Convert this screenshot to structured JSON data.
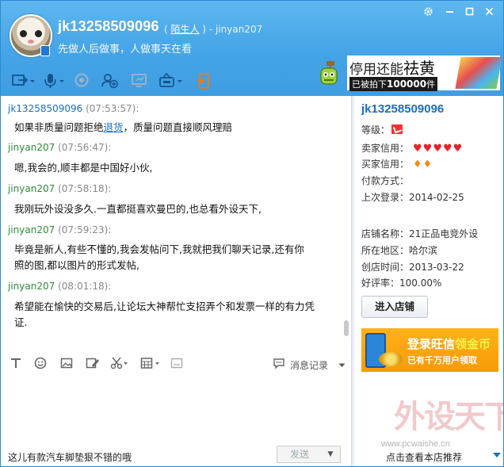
{
  "header": {
    "nickname": "jk13258509096",
    "relation_tag": "陌生人",
    "relation_suffix": " ) - jinyan207",
    "relation_prefix": "( ",
    "motto": "先做人后做事，人做事天在看",
    "window_controls": [
      "settings-icon",
      "minimize-icon",
      "maximize-icon",
      "close-icon"
    ]
  },
  "promo_banner": {
    "line1_a": "停用还能",
    "line1_b": "祛黄",
    "line2_a": "已被拍下",
    "line2_num": "100000",
    "line2_b": "件"
  },
  "messages": [
    {
      "sender": "jk13258509096",
      "time": "(07:53:57):",
      "role": "other",
      "text_a": "如果非质量问题拒绝",
      "link": "退货",
      "text_b": "，质量问题直接顺风理赔"
    },
    {
      "sender": "jinyan207",
      "time": "(07:56:47):",
      "role": "me",
      "text_a": "嗯,我会的,顺丰都是中国好小伙,"
    },
    {
      "sender": "jinyan207",
      "time": "(07:58:18):",
      "role": "me",
      "text_a": "我刚玩外设没多久.一直都挺喜欢曼巴的,也总看外设天下,"
    },
    {
      "sender": "jinyan207",
      "time": "(07:59:23):",
      "role": "me",
      "text_a": "毕竟是新人,有些不懂的,我会发帖问下,我就把我们聊天记录,还有你",
      "text_c": "照的图,都以图片的形式发帖,"
    },
    {
      "sender": "jinyan207",
      "time": "(08:01:18):",
      "role": "me",
      "text_a": "希望能在愉快的交易后,让论坛大神帮忙支招弄个和发票一样的有力凭",
      "text_c": "证."
    }
  ],
  "input_toolbar": {
    "history_label": "消息记录"
  },
  "input": {
    "draft": "这儿有款汽车脚垫狠不错的哦",
    "send_label": "发送"
  },
  "profile": {
    "name": "jk13258509096",
    "level_label": "等级：",
    "seller_label": "卖家信用：",
    "buyer_label": "买家信用：",
    "pay_label": "付款方式：",
    "last_login_label": "上次登录：",
    "last_login": "2014-02-25",
    "shop_label": "店铺名称：",
    "shop_name": "21正品电竞外设",
    "region_label": "所在地区：",
    "region": "哈尔滨",
    "created_label": "创店时间：",
    "created": "2013-03-22",
    "rating_label": "好评率：",
    "rating": "100.00%",
    "enter_shop": "进入店铺",
    "seller_hearts": 5,
    "buyer_diamonds": 2
  },
  "ad": {
    "line1_a": "登录旺信",
    "line1_b": "领金币",
    "line2": "已有千万用户领取"
  },
  "watermark": {
    "text": "外设天下",
    "url": "www.pcwaishe.cn"
  },
  "footer": {
    "view_shop_recommend": "点击查看本店推荐"
  },
  "colors": {
    "header_blue": "#45a4e6",
    "link_blue": "#1a6fc4",
    "me_green": "#2e8b3a",
    "ad_orange": "#f79a08"
  }
}
